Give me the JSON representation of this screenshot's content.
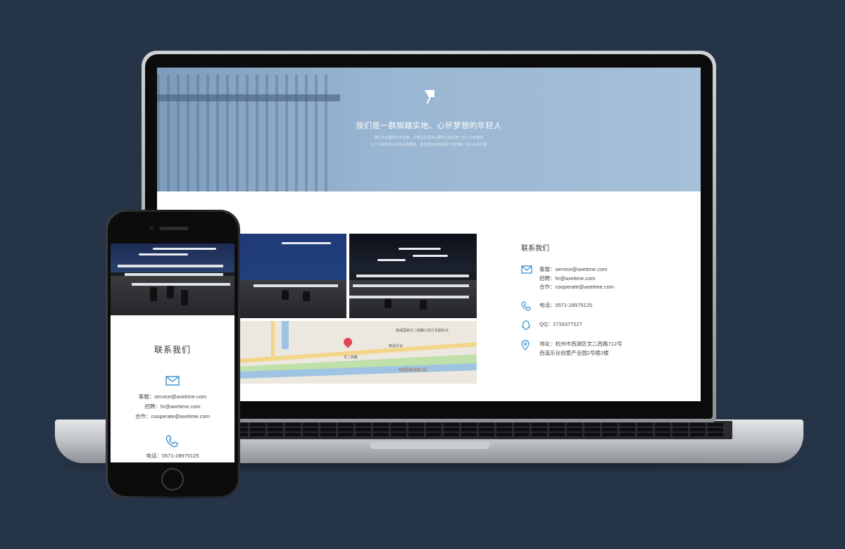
{
  "colors": {
    "background": "#253446",
    "accent": "#3a8fd0",
    "hero": "#98b5d1"
  },
  "hero": {
    "icon": "flag-icon",
    "title": "我们是一群脚踏实地、心怀梦想的年轻人",
    "subtitle_lines": [
      "我们不太聪明也不太笨，只想在生活的小细节上给大家一份小小的快乐",
      "为了不辜负那么多信任的眼睛，我们坚持在西溪这个地方做一份小小的力量"
    ]
  },
  "contact": {
    "title": "联系我们",
    "email_icon": "envelope-icon",
    "service_label": "客服：",
    "service": "service@axetime.com",
    "hr_label": "招聘：",
    "hr": "hr@axetime.com",
    "coop_label": "合作：",
    "coop": "cooperate@axetime.com",
    "phone_icon": "phone-icon",
    "phone_label": "电话：",
    "phone": "0571-28975125",
    "qq_icon": "qq-icon",
    "qq_label": "QQ：",
    "qq": "2716377227",
    "address_icon": "location-pin-icon",
    "address_label": "地址：",
    "address_line1": "杭州市西湖区文二西路712号",
    "address_line2": "西溪乐谷创意产业园2号楼2楼"
  },
  "map": {
    "labels": [
      "西溪乐谷",
      "文二西路",
      "西溪国家湿地公园",
      "西溪国家文二西路口自行车服务点"
    ]
  },
  "phone": {
    "contact_title": "联系我们",
    "service_line": "客服：service@axetime.com",
    "hr_line": "招聘：hr@axetime.com",
    "coop_line": "合作：cooperate@axetime.com",
    "phone_line": "电话：0571-28975125"
  }
}
